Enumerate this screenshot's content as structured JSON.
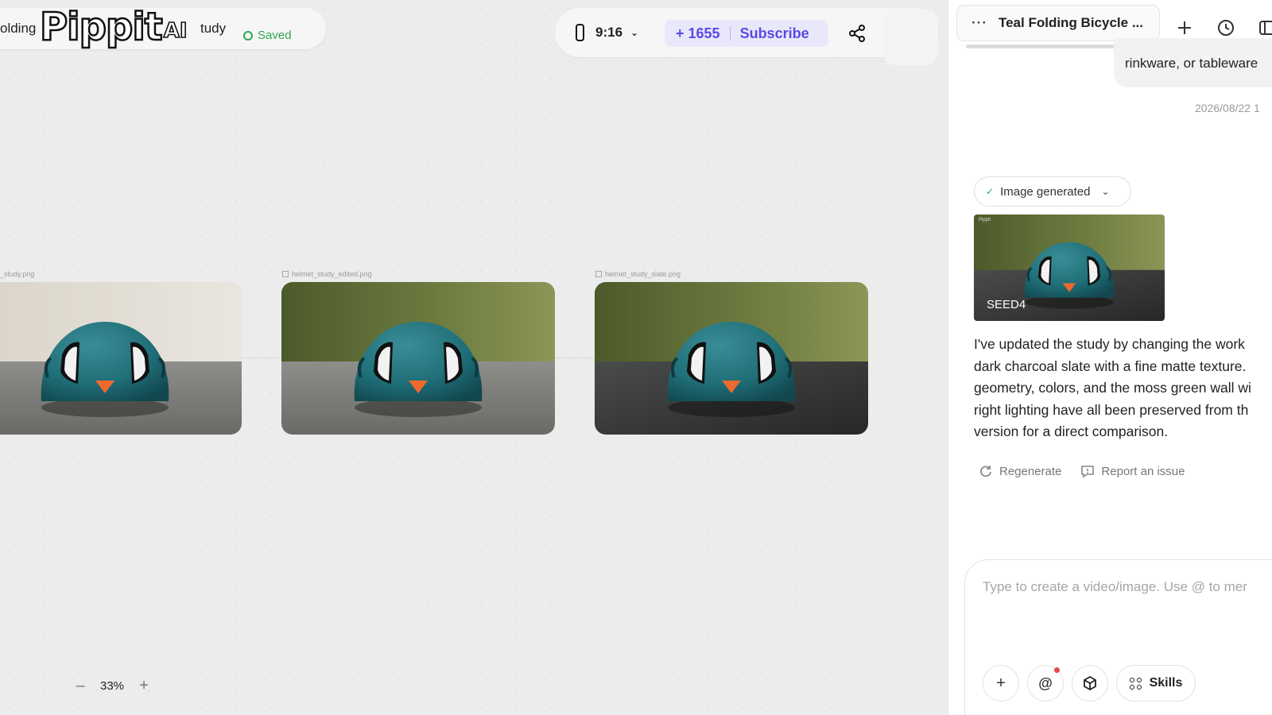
{
  "header": {
    "project_name_start": "olding",
    "project_name_end": "tudy",
    "logo_word": "Pippit",
    "logo_suffix": "AI",
    "saved_label": "Saved",
    "aspect_ratio": "9:16",
    "credits": "+ 1655",
    "subscribe_label": "Subscribe"
  },
  "canvas": {
    "images": [
      {
        "filename": "_study.png"
      },
      {
        "filename": "helmet_study_edited.png"
      },
      {
        "filename": "helmet_study_slate.png"
      }
    ],
    "zoom": "33%",
    "left_fragment": ")"
  },
  "panel": {
    "chat_title": "Teal Folding Bicycle ...",
    "user_message": "rinkware, or tableware",
    "timestamp": "2026/08/22 1",
    "status_pill": "Image generated",
    "thumbnail_badge": "SEED4",
    "thumbnail_tiny": "Pippit",
    "reply_lines": [
      "I've updated the study by changing the work",
      "dark charcoal slate with a fine matte texture.",
      "geometry, colors, and the moss green wall wi",
      "right lighting have all been preserved from th",
      "version for a direct comparison."
    ],
    "regenerate_label": "Regenerate",
    "report_label": "Report an issue",
    "composer_placeholder": "Type to create a video/image. Use @ to mer",
    "skills_label": "Skills"
  },
  "colors": {
    "accent": "#5a48e4",
    "saved_green": "#2fa84f",
    "helmet_teal": "#1f6e78",
    "wall_green": "#5a6a32"
  }
}
